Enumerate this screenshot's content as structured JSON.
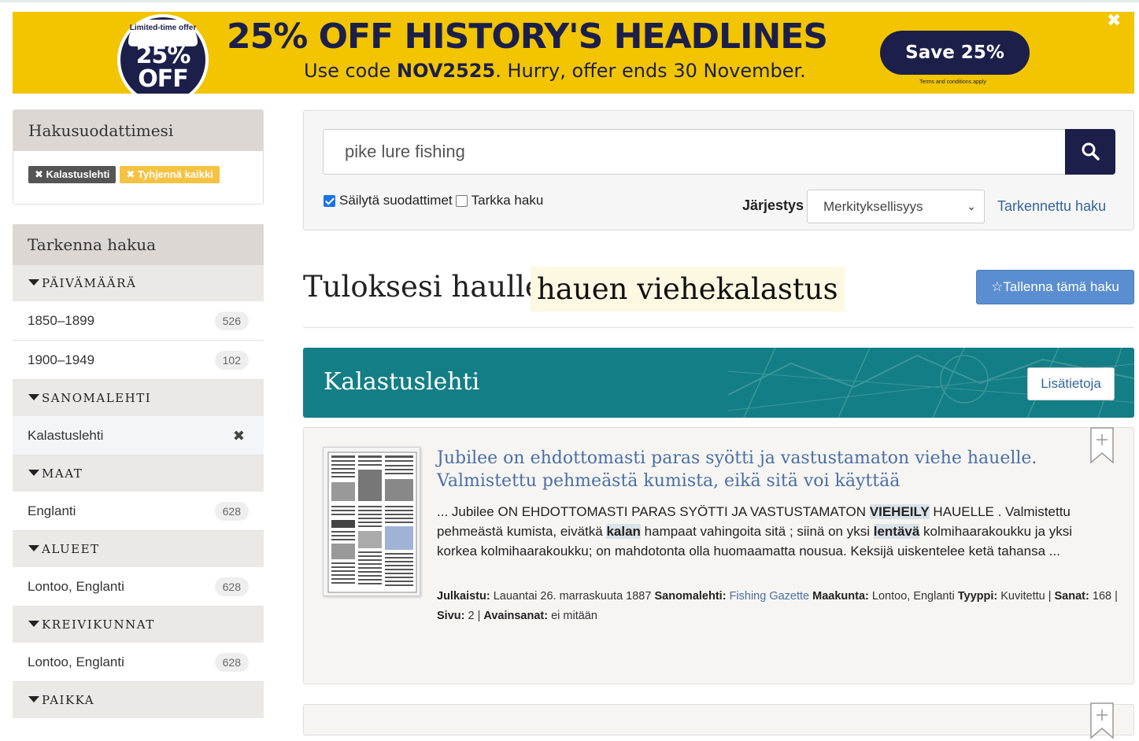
{
  "banner": {
    "badge_top": "Limited-time offer",
    "badge_big": "25% OFF",
    "title": "25% OFF HISTORY'S HEADLINES",
    "sub_prefix": "Use code ",
    "sub_code": "NOV2525",
    "sub_suffix": ". Hurry, offer ends 30 November.",
    "button": "Save 25%",
    "terms": "Terms and conditions apply",
    "close": "✖"
  },
  "filters": {
    "heading": "Hakusuodattimesi",
    "chips": [
      "✖ Kalastuslehti",
      "✖ Tyhjennä kaikki"
    ]
  },
  "refine": {
    "heading": "Tarkenna hakua",
    "facets": [
      {
        "title": "PÄIVÄMÄÄRÄ",
        "items": [
          {
            "label": "1850–1899",
            "count": "526"
          },
          {
            "label": "1900–1949",
            "count": "102"
          }
        ]
      },
      {
        "title": "SANOMALEHTI",
        "items": [
          {
            "label": "Kalastuslehti",
            "count": "✖"
          }
        ]
      },
      {
        "title": "MAAT",
        "items": [
          {
            "label": "Englanti",
            "count": "628"
          }
        ]
      },
      {
        "title": "ALUEET",
        "items": [
          {
            "label": "Lontoo, Englanti",
            "count": "628"
          }
        ]
      },
      {
        "title": "KREIVIKUNNAT",
        "items": [
          {
            "label": "Lontoo, Englanti",
            "count": "628"
          }
        ]
      },
      {
        "title": "PAIKKA",
        "items": []
      }
    ]
  },
  "search": {
    "query": "pike lure fishing",
    "keep_filters_label": "Säilytä suodattimet",
    "exact_label": "Tarkka haku",
    "sort_label": "Järjestys",
    "sort_value": "Merkityksellisyys",
    "advanced_link": "Tarkennettu haku"
  },
  "results": {
    "title": "Tuloksesi haulle:",
    "term": "hauen viehekalastus",
    "save_button": "☆Tallenna tämä haku"
  },
  "newspaper": {
    "name": "Kalastuslehti",
    "more_button": "Lisätietoja"
  },
  "result1": {
    "title": "Jubilee on ehdottomasti paras syötti ja vastustamaton viehe hauelle. Valmistettu pehmeästä kumista, eikä sitä voi käyttää",
    "snippet_parts": [
      "... Jubilee ON EHDOTTOMASTI PARAS SYÖTTI JA VASTUSTAMATON ",
      "VIEHEILY",
      " HAUELLE . Valmistettu pehmeästä kumista, eivätkä ",
      "kalan",
      " hampaat vahingoita sitä ; siinä on yksi ",
      "lentävä",
      " kolmihaarakoukku ja yksi korkea kolmihaarakoukku; on mahdotonta olla huomaamatta nousua. Keksijä uiskentelee ketä tahansa ..."
    ],
    "meta": {
      "published_label": "Julkaistu:",
      "published": "Lauantai 26. marraskuuta 1887",
      "paper_label": "Sanomalehti:",
      "paper": "Fishing Gazette",
      "county_label": "Maakunta:",
      "county": "Lontoo, Englanti",
      "type_label": "Tyyppi:",
      "type": "Kuvitettu",
      "words_label": "Sanat:",
      "words": "168",
      "page_label": "Sivu:",
      "page": "2",
      "keywords_label": "Avainsanat:",
      "keywords": "ei mitään"
    }
  },
  "colors": {
    "banner_bg": "#f2c500",
    "navy": "#1c1f4a",
    "teal": "#137e85",
    "link": "#4a6fa5",
    "save_btn": "#5b8ed0"
  }
}
